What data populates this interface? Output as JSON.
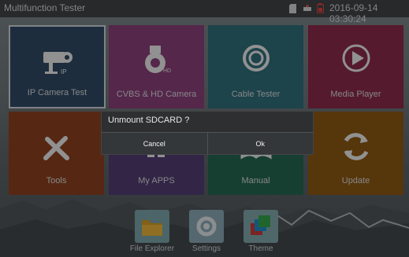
{
  "status_bar": {
    "title": "Multifunction Tester",
    "datetime": "2016-09-14 03:30:24",
    "icons": [
      "sd-card-icon",
      "network-icon",
      "battery-icon"
    ]
  },
  "tiles": [
    {
      "label": "IP Camera Test",
      "icon": "ip-camera-icon",
      "color": "#2f4a63"
    },
    {
      "label": "CVBS & HD Camera",
      "icon": "dome-camera-icon",
      "color": "#8a3f7a"
    },
    {
      "label": "Cable Tester",
      "icon": "cable-icon",
      "color": "#2f6d79"
    },
    {
      "label": "Media Player",
      "icon": "play-icon",
      "color": "#8a2b4a"
    },
    {
      "label": "Tools",
      "icon": "tools-icon",
      "color": "#8b4221"
    },
    {
      "label": "My APPS",
      "icon": "apps-icon",
      "color": "#513d72"
    },
    {
      "label": "Manual",
      "icon": "book-icon",
      "color": "#24674f"
    },
    {
      "label": "Update",
      "icon": "refresh-icon",
      "color": "#8c5813"
    }
  ],
  "dock": [
    {
      "label": "File Explorer",
      "icon": "folder-icon"
    },
    {
      "label": "Settings",
      "icon": "gear-icon"
    },
    {
      "label": "Theme",
      "icon": "theme-icon"
    }
  ],
  "dialog": {
    "title": "Unmount SDCARD ?",
    "cancel_label": "Cancel",
    "ok_label": "Ok"
  }
}
